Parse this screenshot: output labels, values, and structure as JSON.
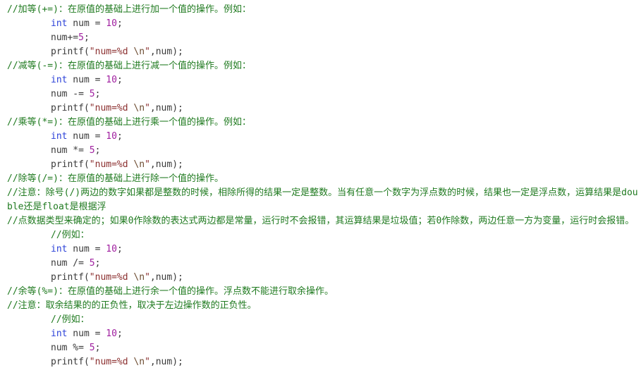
{
  "editor": {
    "language": "c",
    "theme": "light",
    "background": "#ffffff",
    "colors": {
      "comment": "#1f7a1f",
      "keyword": "#2b41d8",
      "identifier": "#3a3a3a",
      "number": "#a020a0",
      "string": "#8b2f2f",
      "escape": "#6b4a2f"
    }
  },
  "lines": [
    {
      "id": "l01",
      "type": "comment",
      "indent": false,
      "wrap": false,
      "text": "//加等(+=)：在原值的基础上进行加一个值的操作。例如："
    },
    {
      "id": "l02",
      "type": "code",
      "indent": true,
      "wrap": false,
      "parts": [
        {
          "t": "kw",
          "v": "int"
        },
        {
          "t": "id",
          "v": " num = "
        },
        {
          "t": "num",
          "v": "10"
        },
        {
          "t": "id",
          "v": ";"
        }
      ]
    },
    {
      "id": "l03",
      "type": "code",
      "indent": true,
      "wrap": false,
      "parts": [
        {
          "t": "id",
          "v": "num+="
        },
        {
          "t": "num",
          "v": "5"
        },
        {
          "t": "id",
          "v": ";"
        }
      ]
    },
    {
      "id": "l04",
      "type": "code",
      "indent": true,
      "wrap": false,
      "parts": [
        {
          "t": "id",
          "v": "printf("
        },
        {
          "t": "str",
          "v": "\"num=%d "
        },
        {
          "t": "esc",
          "v": "\\n"
        },
        {
          "t": "str",
          "v": "\""
        },
        {
          "t": "id",
          "v": ",num);"
        }
      ]
    },
    {
      "id": "l05",
      "type": "comment",
      "indent": false,
      "wrap": false,
      "text": "//减等(-=)：在原值的基础上进行减一个值的操作。例如："
    },
    {
      "id": "l06",
      "type": "code",
      "indent": true,
      "wrap": false,
      "parts": [
        {
          "t": "kw",
          "v": "int"
        },
        {
          "t": "id",
          "v": " num = "
        },
        {
          "t": "num",
          "v": "10"
        },
        {
          "t": "id",
          "v": ";"
        }
      ]
    },
    {
      "id": "l07",
      "type": "code",
      "indent": true,
      "wrap": false,
      "parts": [
        {
          "t": "id",
          "v": "num -= "
        },
        {
          "t": "num",
          "v": "5"
        },
        {
          "t": "id",
          "v": ";"
        }
      ]
    },
    {
      "id": "l08",
      "type": "code",
      "indent": true,
      "wrap": false,
      "parts": [
        {
          "t": "id",
          "v": "printf("
        },
        {
          "t": "str",
          "v": "\"num=%d "
        },
        {
          "t": "esc",
          "v": "\\n"
        },
        {
          "t": "str",
          "v": "\""
        },
        {
          "t": "id",
          "v": ",num);"
        }
      ]
    },
    {
      "id": "l09",
      "type": "comment",
      "indent": false,
      "wrap": false,
      "text": "//乘等(*=)：在原值的基础上进行乘一个值的操作。例如："
    },
    {
      "id": "l10",
      "type": "code",
      "indent": true,
      "wrap": false,
      "parts": [
        {
          "t": "kw",
          "v": "int"
        },
        {
          "t": "id",
          "v": " num = "
        },
        {
          "t": "num",
          "v": "10"
        },
        {
          "t": "id",
          "v": ";"
        }
      ]
    },
    {
      "id": "l11",
      "type": "code",
      "indent": true,
      "wrap": false,
      "parts": [
        {
          "t": "id",
          "v": "num *= "
        },
        {
          "t": "num",
          "v": "5"
        },
        {
          "t": "id",
          "v": ";"
        }
      ]
    },
    {
      "id": "l12",
      "type": "code",
      "indent": true,
      "wrap": false,
      "parts": [
        {
          "t": "id",
          "v": "printf("
        },
        {
          "t": "str",
          "v": "\"num=%d "
        },
        {
          "t": "esc",
          "v": "\\n"
        },
        {
          "t": "str",
          "v": "\""
        },
        {
          "t": "id",
          "v": ",num);"
        }
      ]
    },
    {
      "id": "l13",
      "type": "comment",
      "indent": false,
      "wrap": false,
      "text": "//除等(/=)：在原值的基础上进行除一个值的操作。"
    },
    {
      "id": "l14",
      "type": "comment",
      "indent": false,
      "wrap": true,
      "text": " //注意：除号(/)两边的数字如果都是整数的时候，相除所得的结果一定是整数。当有任意一个数字为浮点数的时候，结果也一定是浮点数，运算结果是double还是float是根据浮"
    },
    {
      "id": "l15",
      "type": "comment",
      "indent": false,
      "wrap": true,
      "text": " //点数据类型来确定的；如果0作除数的表达式两边都是常量，运行时不会报错，其运算结果是垃圾值；若0作除数，两边任意一方为变量，运行时会报错。"
    },
    {
      "id": "l16",
      "type": "comment",
      "indent": true,
      "wrap": false,
      "text": "//例如："
    },
    {
      "id": "l17",
      "type": "code",
      "indent": true,
      "wrap": false,
      "parts": [
        {
          "t": "kw",
          "v": "int"
        },
        {
          "t": "id",
          "v": " num = "
        },
        {
          "t": "num",
          "v": "10"
        },
        {
          "t": "id",
          "v": ";"
        }
      ]
    },
    {
      "id": "l18",
      "type": "code",
      "indent": true,
      "wrap": false,
      "parts": [
        {
          "t": "id",
          "v": "num /= "
        },
        {
          "t": "num",
          "v": "5"
        },
        {
          "t": "id",
          "v": ";"
        }
      ]
    },
    {
      "id": "l19",
      "type": "code",
      "indent": true,
      "wrap": false,
      "parts": [
        {
          "t": "id",
          "v": "printf("
        },
        {
          "t": "str",
          "v": "\"num=%d "
        },
        {
          "t": "esc",
          "v": "\\n"
        },
        {
          "t": "str",
          "v": "\""
        },
        {
          "t": "id",
          "v": ",num);"
        }
      ]
    },
    {
      "id": "l20",
      "type": "comment",
      "indent": false,
      "wrap": false,
      "text": "//余等(%=)：在原值的基础上进行余一个值的操作。浮点数不能进行取余操作。"
    },
    {
      "id": "l21",
      "type": "comment",
      "indent": false,
      "wrap": false,
      "text": "//注意：取余结果的的正负性，取决于左边操作数的正负性。"
    },
    {
      "id": "l22",
      "type": "comment",
      "indent": true,
      "wrap": false,
      "text": "//例如："
    },
    {
      "id": "l23",
      "type": "code",
      "indent": true,
      "wrap": false,
      "parts": [
        {
          "t": "kw",
          "v": "int"
        },
        {
          "t": "id",
          "v": " num = "
        },
        {
          "t": "num",
          "v": "10"
        },
        {
          "t": "id",
          "v": ";"
        }
      ]
    },
    {
      "id": "l24",
      "type": "code",
      "indent": true,
      "wrap": false,
      "parts": [
        {
          "t": "id",
          "v": "num %= "
        },
        {
          "t": "num",
          "v": "5"
        },
        {
          "t": "id",
          "v": ";"
        }
      ]
    },
    {
      "id": "l25",
      "type": "code",
      "indent": true,
      "wrap": false,
      "parts": [
        {
          "t": "id",
          "v": "printf("
        },
        {
          "t": "str",
          "v": "\"num=%d "
        },
        {
          "t": "esc",
          "v": "\\n"
        },
        {
          "t": "str",
          "v": "\""
        },
        {
          "t": "id",
          "v": ",num);"
        }
      ]
    }
  ]
}
